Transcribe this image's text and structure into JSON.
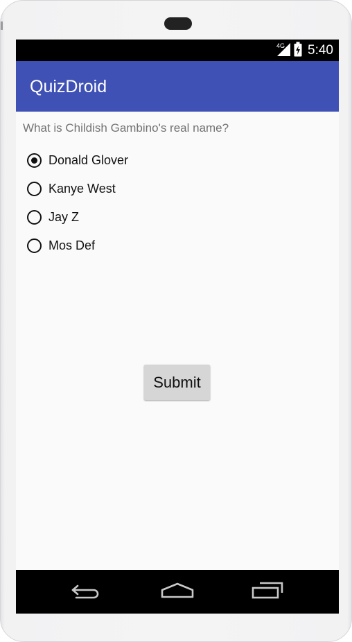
{
  "status_bar": {
    "network_label": "4G",
    "time": "5:40"
  },
  "app_bar": {
    "title": "QuizDroid"
  },
  "quiz": {
    "question": "What is Childish Gambino's real name?",
    "options": [
      {
        "label": "Donald Glover",
        "checked": true
      },
      {
        "label": "Kanye West",
        "checked": false
      },
      {
        "label": "Jay Z",
        "checked": false
      },
      {
        "label": "Mos Def",
        "checked": false
      }
    ],
    "submit_label": "Submit"
  },
  "nav_bar": {
    "icons": [
      "back-icon",
      "home-icon",
      "recents-icon"
    ]
  },
  "colors": {
    "app_bar": "#3f51b5",
    "background": "#fafafa",
    "button": "#d6d6d6"
  }
}
